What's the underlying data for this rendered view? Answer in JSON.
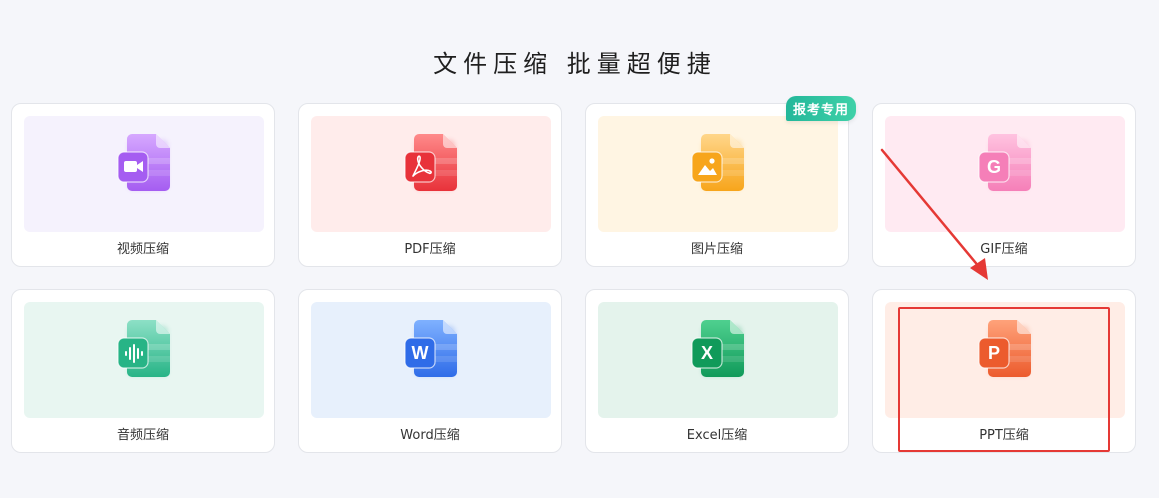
{
  "header": {
    "title": "文件压缩  批量超便捷"
  },
  "cards": [
    {
      "label": "视频压缩",
      "icon": "video-file-icon",
      "glyph": "",
      "bg": "#f5f2fd",
      "color_top": "#d6a8ff",
      "color_bottom": "#a55df1"
    },
    {
      "label": "PDF压缩",
      "icon": "pdf-file-icon",
      "glyph": "",
      "bg": "#ffeceb",
      "color_top": "#ff8a8a",
      "color_bottom": "#e8323a"
    },
    {
      "label": "图片压缩",
      "icon": "image-file-icon",
      "glyph": "",
      "bg": "#fff5e3",
      "color_top": "#ffd68a",
      "color_bottom": "#f7a51b",
      "badge": "报考专用"
    },
    {
      "label": "GIF压缩",
      "icon": "gif-file-icon",
      "glyph": "G",
      "bg": "#ffeaf2",
      "color_top": "#ffc3e0",
      "color_bottom": "#f57fb8"
    },
    {
      "label": "音频压缩",
      "icon": "audio-file-icon",
      "glyph": "",
      "bg": "#e8f6f1",
      "color_top": "#8de0c6",
      "color_bottom": "#27b486"
    },
    {
      "label": "Word压缩",
      "icon": "word-file-icon",
      "glyph": "W",
      "bg": "#e7f0fc",
      "color_top": "#7fb1ff",
      "color_bottom": "#2f6ce8"
    },
    {
      "label": "Excel压缩",
      "icon": "excel-file-icon",
      "glyph": "X",
      "bg": "#e4f3ec",
      "color_top": "#4fd08f",
      "color_bottom": "#109a5a"
    },
    {
      "label": "PPT压缩",
      "icon": "ppt-file-icon",
      "glyph": "P",
      "bg": "#ffede6",
      "color_top": "#ffa27a",
      "color_bottom": "#ec5b2d"
    }
  ],
  "annotation": {
    "color": "#e53935"
  }
}
